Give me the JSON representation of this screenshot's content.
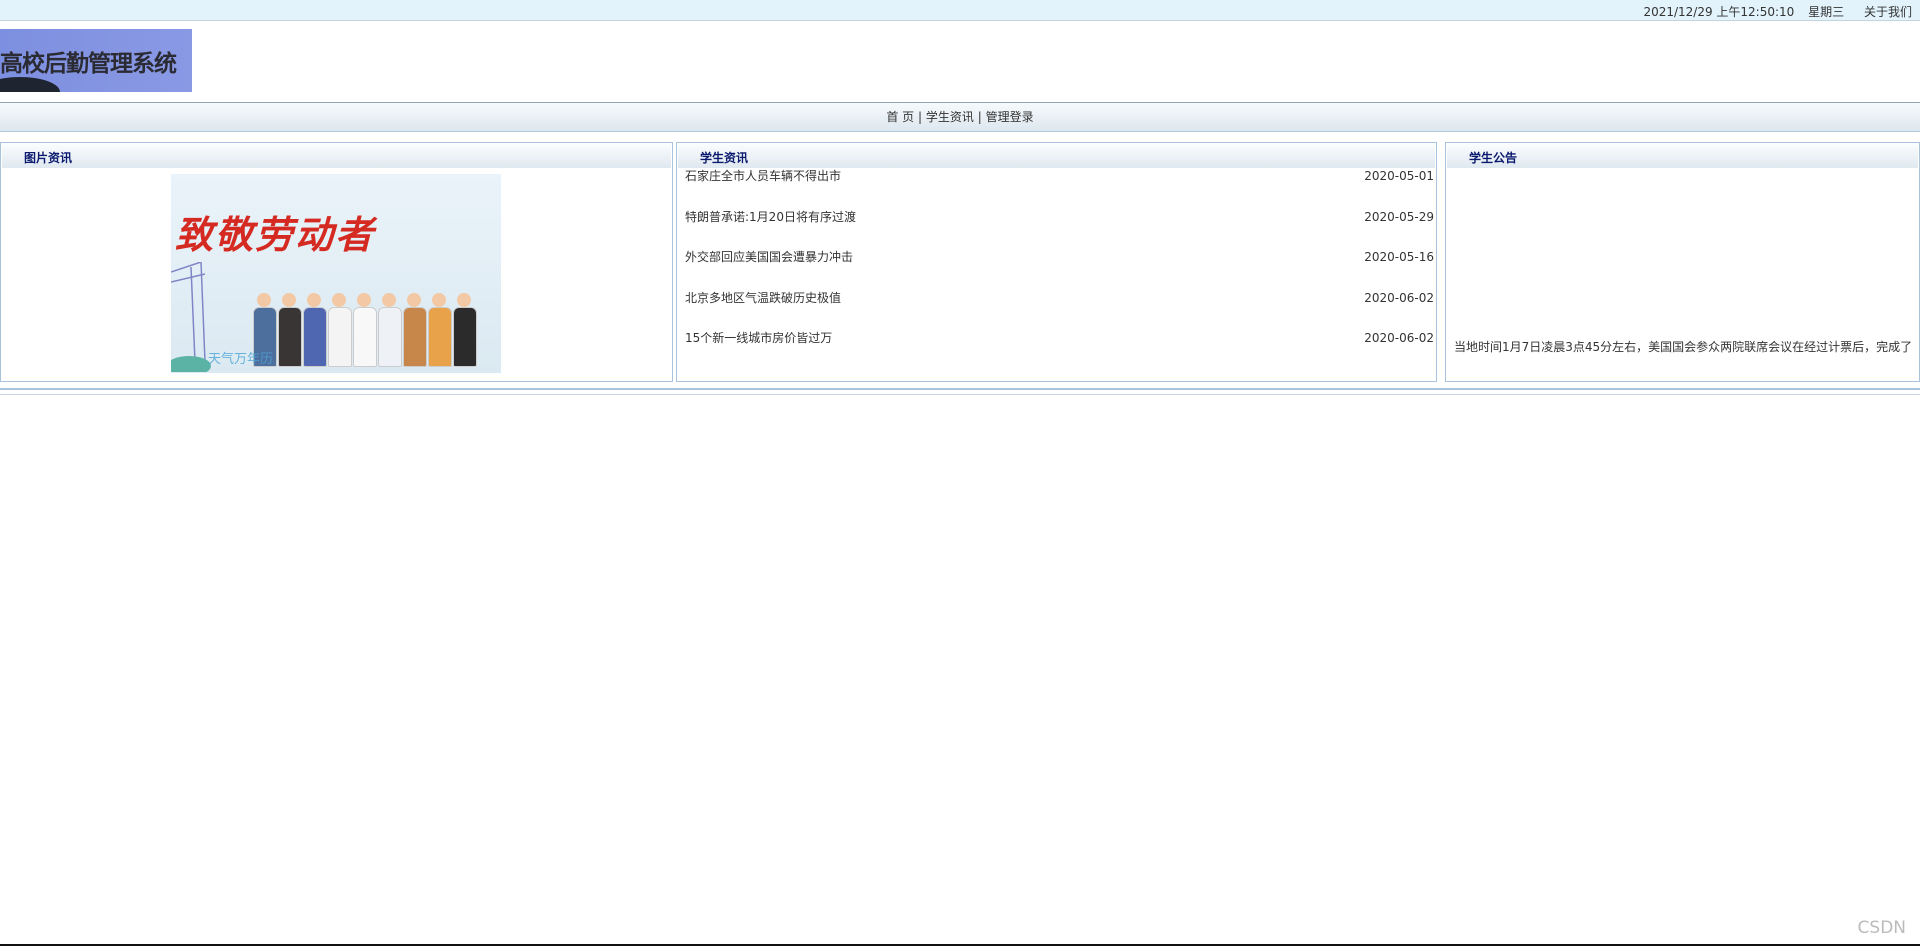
{
  "topbar": {
    "datetime": "2021/12/29 上午12:50:10",
    "weekday": "星期三",
    "about": "关于我们"
  },
  "header": {
    "logo_text": "高校后勤管理系统"
  },
  "nav": {
    "items": [
      {
        "label": "首 页"
      },
      {
        "label": "学生资讯"
      },
      {
        "label": "管理登录"
      }
    ],
    "separator": "|"
  },
  "picture_panel": {
    "title": "图片资讯",
    "image": {
      "slogan": "致敬劳动者",
      "watermark": "天气万年历"
    }
  },
  "news_panel": {
    "title": "学生资讯",
    "items": [
      {
        "title": "石家庄全市人员车辆不得出市",
        "date": "2020-05-01"
      },
      {
        "title": "特朗普承诺:1月20日将有序过渡",
        "date": "2020-05-29"
      },
      {
        "title": "外交部回应美国国会遭暴力冲击",
        "date": "2020-05-16"
      },
      {
        "title": "北京多地区气温跌破历史极值",
        "date": "2020-06-02"
      },
      {
        "title": "15个新一线城市房价皆过万",
        "date": "2020-06-02"
      }
    ]
  },
  "notice_panel": {
    "title": "学生公告",
    "text": "当地时间1月7日凌晨3点45分左右，美国国会参众两院联席会议在经过计票后，完成了"
  },
  "watermark": "CSDN",
  "colors": {
    "panel_title": "#0b1a6e",
    "slogan": "#d52a22",
    "topbar_bg": "#e2f3fb"
  }
}
